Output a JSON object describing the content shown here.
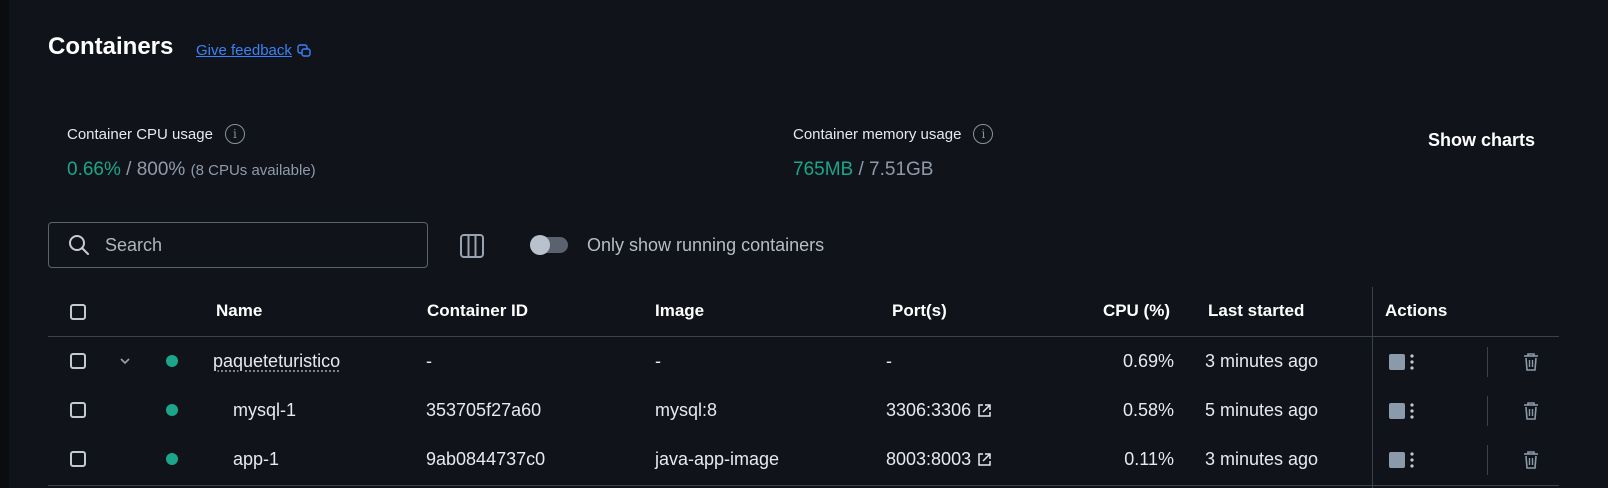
{
  "header": {
    "title": "Containers",
    "feedback_label": "Give feedback"
  },
  "cpu": {
    "label": "Container CPU usage",
    "used": "0.66%",
    "separator": " / ",
    "total": "800%",
    "note": "(8 CPUs available)"
  },
  "memory": {
    "label": "Container memory usage",
    "used": "765MB",
    "separator": " / ",
    "total": "7.51GB"
  },
  "show_charts_label": "Show charts",
  "toolbar": {
    "search_placeholder": "Search",
    "search_value": "",
    "toggle_label": "Only show running containers",
    "toggle_on": false
  },
  "table": {
    "columns": {
      "name": "Name",
      "container_id": "Container ID",
      "image": "Image",
      "ports": "Port(s)",
      "cpu": "CPU (%)",
      "last_started": "Last started",
      "actions": "Actions"
    },
    "rows": [
      {
        "name": "paqueteturistico",
        "container_id": "-",
        "image": "-",
        "ports": "-",
        "cpu": "0.69%",
        "last_started": "3 minutes ago"
      },
      {
        "name": "mysql-1",
        "container_id": "353705f27a60",
        "image": "mysql:8",
        "ports": "3306:3306",
        "cpu": "0.58%",
        "last_started": "5 minutes ago"
      },
      {
        "name": "app-1",
        "container_id": "9ab0844737c0",
        "image": "java-app-image",
        "ports": "8003:8003",
        "cpu": "0.11%",
        "last_started": "3 minutes ago"
      }
    ]
  },
  "colors": {
    "background": "#10131a",
    "accent_green": "#1ba58a",
    "link_blue": "#3b82f6",
    "muted": "#8f9bab"
  },
  "icons": {
    "feedback": "feedback-icon",
    "info": "info-icon",
    "search": "search-icon",
    "columns": "columns-icon",
    "chevron": "chevron-down-icon",
    "status": "running-status-dot",
    "external": "external-link-icon",
    "stop": "stop-icon",
    "more": "kebab-menu-icon",
    "delete": "trash-icon"
  }
}
